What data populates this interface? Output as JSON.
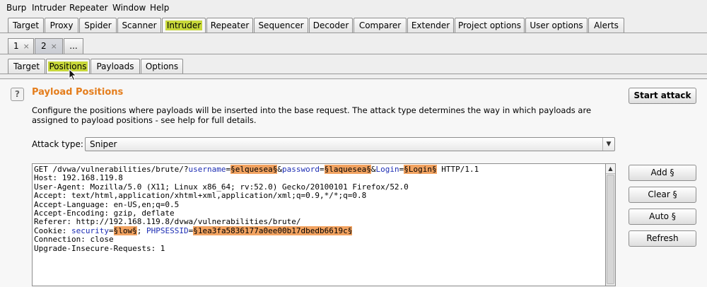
{
  "menubar": {
    "items": [
      "Burp",
      "Intruder",
      "Repeater",
      "Window",
      "Help"
    ]
  },
  "main_tabs": [
    "Target",
    "Proxy",
    "Spider",
    "Scanner",
    "Intruder",
    "Repeater",
    "Sequencer",
    "Decoder",
    "Comparer",
    "Extender",
    "Project options",
    "User options",
    "Alerts"
  ],
  "instance_tabs": {
    "tab1": "1",
    "tab2": "2",
    "more": "...",
    "close_glyph": "×"
  },
  "sub_tabs": [
    "Target",
    "Positions",
    "Payloads",
    "Options"
  ],
  "section": {
    "help_icon": "?",
    "title": "Payload Positions",
    "description": "Configure the positions where payloads will be inserted into the base request. The attack type determines the way in which payloads are assigned to payload positions - see help for full details.",
    "start_attack": "Start attack"
  },
  "attack_type": {
    "label": "Attack type:",
    "value": "Sniper"
  },
  "side_buttons": {
    "add": "Add §",
    "clear": "Clear §",
    "auto": "Auto §",
    "refresh": "Refresh"
  },
  "request": {
    "l1_a": "GET /dvwa/vulnerabilities/brute/?",
    "l1_p1": "username",
    "l1_eq1": "=",
    "l1_m1": "§elquesea§",
    "l1_amp1": "&",
    "l1_p2": "password",
    "l1_eq2": "=",
    "l1_m2": "§laquesea§",
    "l1_amp2": "&",
    "l1_p3": "Login",
    "l1_eq3": "=",
    "l1_m3": "§Login§",
    "l1_end": " HTTP/1.1",
    "l2": "Host: 192.168.119.8",
    "l3": "User-Agent: Mozilla/5.0 (X11; Linux x86_64; rv:52.0) Gecko/20100101 Firefox/52.0",
    "l4": "Accept: text/html,application/xhtml+xml,application/xml;q=0.9,*/*;q=0.8",
    "l5": "Accept-Language: en-US,en;q=0.5",
    "l6": "Accept-Encoding: gzip, deflate",
    "l7": "Referer: http://192.168.119.8/dvwa/vulnerabilities/brute/",
    "l8_a": "Cookie: ",
    "l8_p1": "security",
    "l8_eq1": "=",
    "l8_m1": "§low§",
    "l8_sep": "; ",
    "l8_p2": "PHPSESSID",
    "l8_eq2": "=",
    "l8_m2": "§1ea3fa5836177a0ee00b17dbedb6619c§",
    "l9": "Connection: close",
    "l10": "Upgrade-Insecure-Requests: 1"
  },
  "colors": {
    "title": "#e47d1c",
    "highlight": "#c8d83a",
    "payload_marker": "#f2a361",
    "param_name": "#1c2db4"
  }
}
